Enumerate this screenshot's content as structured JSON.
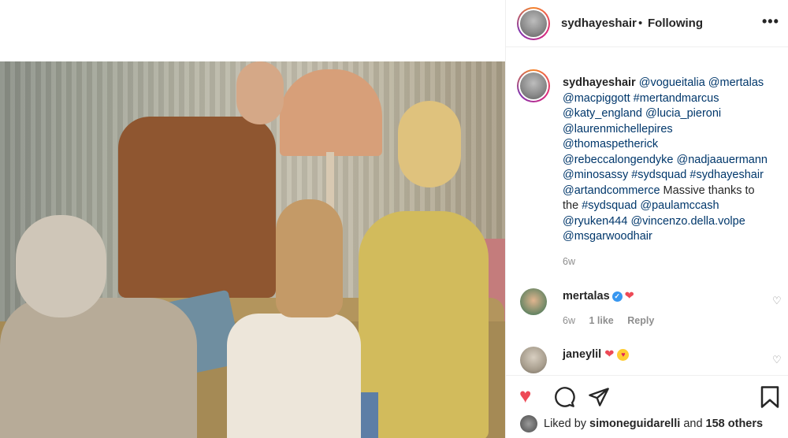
{
  "post": {
    "username": "sydhayeshair",
    "separator": "•",
    "follow_status": "Following",
    "more_label": "•••"
  },
  "caption": {
    "owner": "sydhayeshair",
    "lines": [
      "@vogueitalia @mertalas",
      "@macpiggott #mertandmarcus",
      "@katy_england @lucia_pieroni",
      "@laurenmichellepires",
      "@thomaspetherick",
      "@rebeccalongendyke @nadjaauermann",
      "@minosassy #sydsquad #sydhayeshair",
      "@artandcommerce",
      "Massive thanks to",
      "the",
      "#sydsquad @paulamccash",
      "@ryuken444 @vincenzo.della.volpe",
      "@msgarwoodhair"
    ],
    "time": "6w"
  },
  "comments": [
    {
      "user": "mertalas",
      "verified": true,
      "text": "❤",
      "time": "6w",
      "likes": "1 like",
      "reply": "Reply"
    },
    {
      "user": "janeylil",
      "verified": false,
      "text": "❤",
      "emoji": "😍"
    }
  ],
  "actions": {
    "like_icon": "heart-icon",
    "comment_icon": "comment-icon",
    "share_icon": "share-icon",
    "save_icon": "bookmark-icon",
    "liked_prefix": "Liked by",
    "liked_user": "simoneguidarelli",
    "liked_and": "and",
    "liked_others": "158 others"
  },
  "colors": {
    "accent_red": "#ed4956",
    "link_blue": "#00376b",
    "muted": "#8e8e8e",
    "verified_blue": "#3897f0"
  }
}
